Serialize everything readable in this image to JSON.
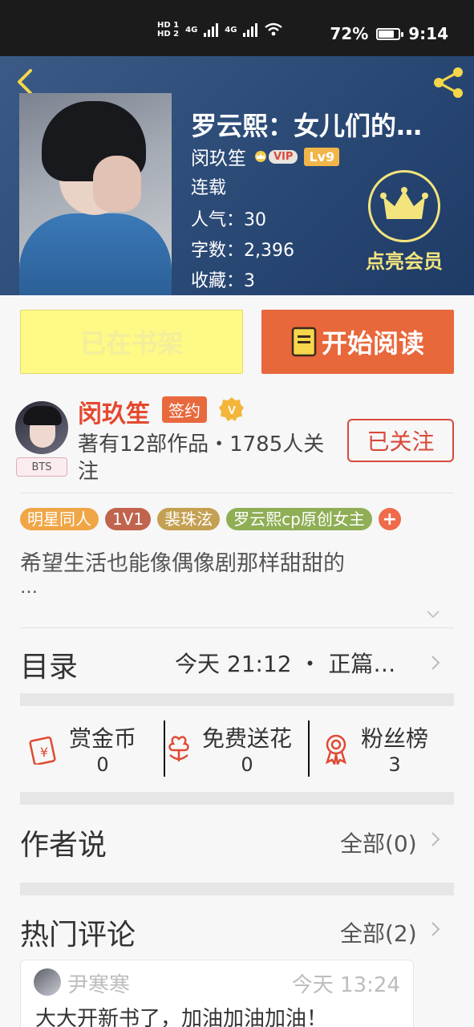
{
  "status_bar": {
    "hd1": "HD 1",
    "hd2": "HD 2",
    "net1": "4G",
    "net2": "4G",
    "battery_percent": "72%",
    "battery_level": 0.72,
    "time": "9:14"
  },
  "book": {
    "title": "罗云熙：女儿们的…",
    "author": "闵玖笙",
    "vip": "VIP",
    "level": "Lv9",
    "status": "连载",
    "popularity": "人气：30",
    "word_count": "字数：2,396",
    "favorites": "收藏：3",
    "member_label": "点亮会员"
  },
  "actions": {
    "shelf_label": "已在书架",
    "read_label": "开始阅读"
  },
  "author": {
    "name": "闵玖笙",
    "signed_badge": "签约",
    "verified_mark": "V",
    "badge_tag": "BTS",
    "works_text": "著有12部作品・1785人关注",
    "follow_label": "已关注"
  },
  "tags": [
    {
      "label": "明星同人",
      "color": "#f0a646"
    },
    {
      "label": "1V1",
      "color": "#c0644d"
    },
    {
      "label": "裴珠泫",
      "color": "#c4a052"
    },
    {
      "label": "罗云熙cp原创女主",
      "color": "#8fae55"
    }
  ],
  "tag_add": "+",
  "intro": {
    "text": "希望生活也能像偶像剧那样甜甜的",
    "ellipsis": "…"
  },
  "catalog": {
    "title": "目录",
    "update": "今天  21:12  ・  正篇…"
  },
  "rewards": [
    {
      "label": "赏金币",
      "count": "0",
      "icon": "red-envelope-icon"
    },
    {
      "label": "免费送花",
      "count": "0",
      "icon": "flower-icon"
    },
    {
      "label": "粉丝榜",
      "count": "3",
      "icon": "medal-icon"
    }
  ],
  "author_says": {
    "title": "作者说",
    "link": "全部(0)"
  },
  "hot_comments": {
    "title": "热门评论",
    "link": "全部(2)",
    "first": {
      "user": "尹寒寒",
      "time": "今天  13:24",
      "text": "大大开新书了，加油加油加油！"
    }
  },
  "colors": {
    "accent_orange": "#e8673b",
    "member_gold": "#f3e47d",
    "shelf_yellow": "#fff985",
    "author_red": "#e4492f"
  }
}
